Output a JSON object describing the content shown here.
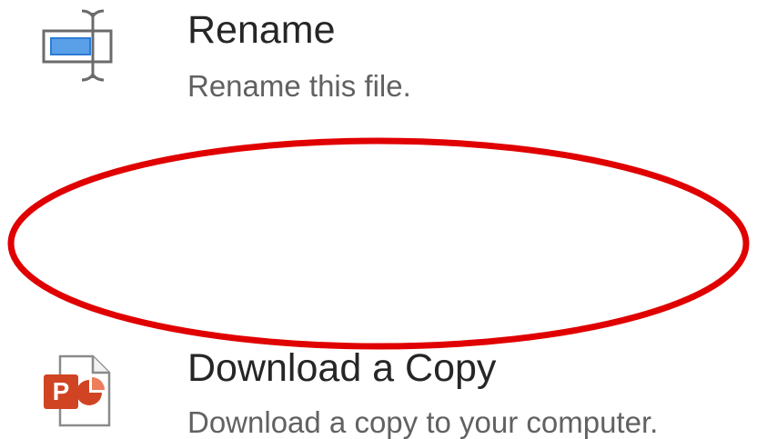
{
  "menu": {
    "items": [
      {
        "id": "rename",
        "title": "Rename",
        "description": "Rename this file.",
        "icon": "rename-icon"
      },
      {
        "id": "download",
        "title": "Download a Copy",
        "description": "Download a copy to your computer.",
        "icon": "powerpoint-file-icon",
        "icon_letter": "P"
      }
    ]
  },
  "highlight": {
    "target": "download",
    "shape": "ellipse",
    "color": "#e00000"
  },
  "colors": {
    "title_text": "#262626",
    "description_text": "#616161",
    "rename_icon_blue": "#2e7bd6",
    "powerpoint_orange": "#d04423"
  }
}
